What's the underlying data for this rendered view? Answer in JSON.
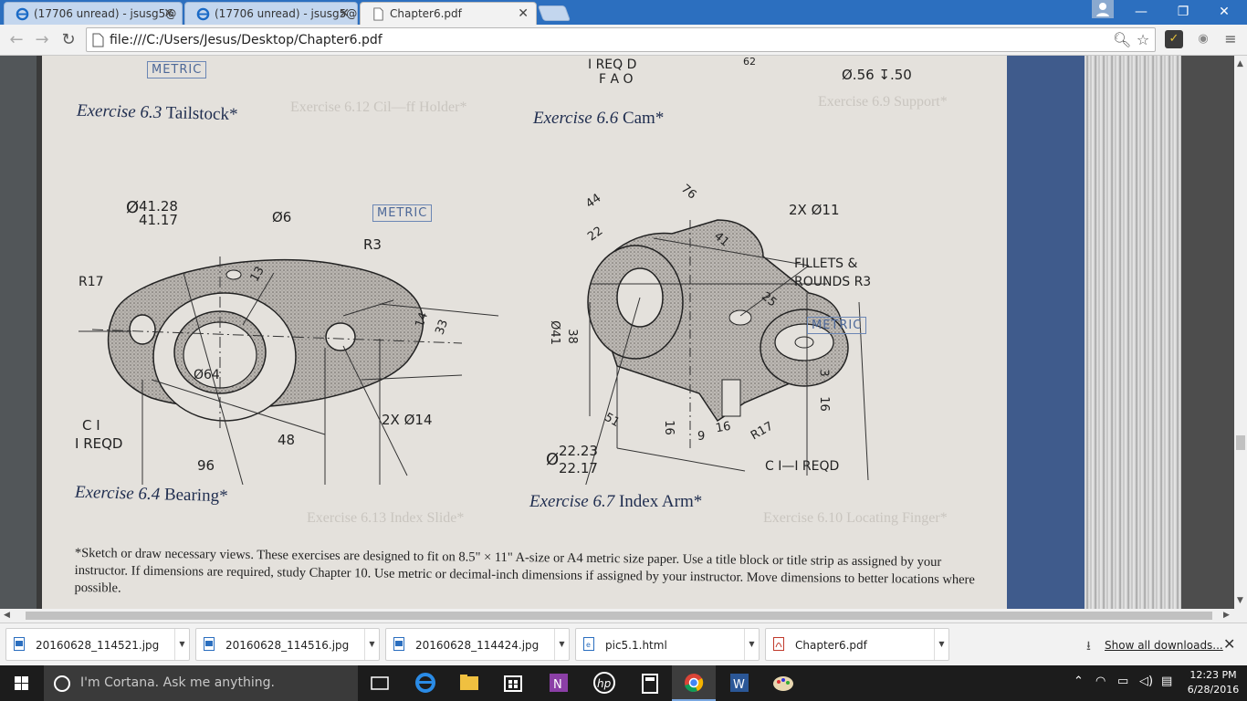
{
  "browser": {
    "tabs": [
      {
        "title": "(17706 unread) - jsusg5@",
        "active": false
      },
      {
        "title": "(17706 unread) - jsusg5@",
        "active": false
      },
      {
        "title": "Chapter6.pdf",
        "active": true
      }
    ],
    "url": "file:///C:/Users/Jesus/Desktop/Chapter6.pdf"
  },
  "pdf": {
    "top": {
      "metric": "METRIC",
      "ireqd": "I REQ D",
      "fao": "F A O",
      "dia": "Ø.56 ↧.50",
      "d62": "62"
    },
    "ex63": {
      "label": "Exercise 6.3",
      "name": "Tailstock*"
    },
    "ex66": {
      "label": "Exercise 6.6",
      "name": "Cam*"
    },
    "ex64": {
      "label": "Exercise 6.4",
      "name": "Bearing*"
    },
    "ex67": {
      "label": "Exercise 6.7",
      "name": "Index Arm*"
    },
    "bearing": {
      "d1a": "41.28",
      "d1b": "41.17",
      "dia_sym": "Ø",
      "d6": "Ø6",
      "metric": "METRIC",
      "r3": "R3",
      "r17": "R17",
      "d13": "13",
      "d14": "14",
      "d33": "33",
      "d64": "Ø64",
      "holes": "2X Ø14",
      "c1": "C I",
      "ireqd": "I REQD",
      "d48": "48",
      "d96": "96"
    },
    "indexarm": {
      "d44": "44",
      "d22": "22",
      "d76": "76",
      "holes": "2X Ø11",
      "d41": "41",
      "fillets1": "FILLETS &",
      "fillets2": "ROUNDS R3",
      "d25": "25",
      "metric": "METRIC",
      "d41v": "Ø41",
      "d38": "38",
      "d3": "3",
      "d16a": "16",
      "d51": "51",
      "d16b": "16",
      "d9": "9",
      "d16c": "16",
      "r17": "R17",
      "dia_a": "22.23",
      "dia_b": "22.17",
      "c1": "C I—I REQD"
    },
    "ghost": {
      "e69": "Exercise 6.9 Support*",
      "e612": "Exercise 6.12 Cil—ff Holder*",
      "e610": "Exercise 6.10 Locating Finger*",
      "e613": "Exercise 6.13 Index Slide*"
    },
    "footnote": "*Sketch or draw necessary views. These exercises are designed to fit on 8.5\" × 11\" A-size or A4 metric size paper. Use a title block or title strip as assigned by your instructor. If dimensions are required, study Chapter 10. Use metric or decimal-inch dimensions if assigned by your instructor. Move dimensions to better locations where possible."
  },
  "downloads": {
    "items": [
      {
        "name": "20160628_114521.jpg"
      },
      {
        "name": "20160628_114516.jpg"
      },
      {
        "name": "20160628_114424.jpg"
      },
      {
        "name": "pic5.1.html"
      },
      {
        "name": "Chapter6.pdf"
      }
    ],
    "show_all": "Show all downloads..."
  },
  "taskbar": {
    "cortana": "I'm Cortana. Ask me anything.",
    "time": "12:23 PM",
    "date": "6/28/2016"
  }
}
